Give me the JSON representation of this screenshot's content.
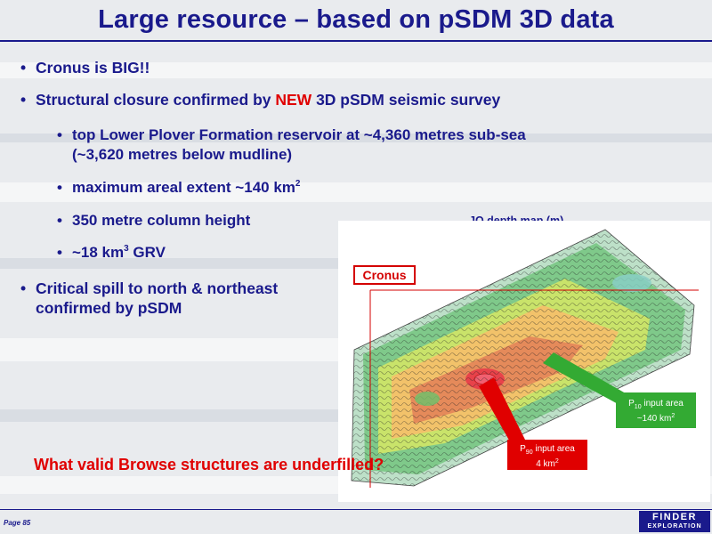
{
  "title": "Large resource – based on pSDM 3D data",
  "bullet_glyph": "•",
  "bullets": {
    "b1": "Cronus is BIG!!",
    "b2_pre": "Structural closure confirmed by ",
    "b2_new": "NEW",
    "b2_post": " 3D pSDM seismic survey",
    "s1_line1": "top Lower Plover Formation reservoir at ~4,360 metres sub-sea",
    "s1_line2": "(~3,620 metres below mudline)",
    "s2_pre": "maximum areal extent ~140 km",
    "s2_sup": "2",
    "s3": "350 metre column height",
    "s4_pre": "~18 km",
    "s4_sup": "3",
    "s4_post": " GRV",
    "b3_line1": "Critical spill to north & northeast",
    "b3_line2": "confirmed by pSDM"
  },
  "map": {
    "label": "JO depth map (m)",
    "cronus_label": "Cronus",
    "p10_pre": "P",
    "p10_sub": "10",
    "p10_post": " input area",
    "p10_area_pre": "~140 km",
    "p10_area_sup": "2",
    "p90_pre": "P",
    "p90_sub": "90",
    "p90_post": " input area",
    "p90_area_pre": "4 km",
    "p90_area_sup": "2"
  },
  "question": "What valid Browse structures are underfilled?",
  "footer": {
    "page": "Page 85",
    "logo_line1": "FINDER",
    "logo_line2": "EXPLORATION"
  },
  "colors": {
    "title_blue": "#1a1a8c",
    "accent_red": "#e00000",
    "callout_green": "#33aa33"
  }
}
